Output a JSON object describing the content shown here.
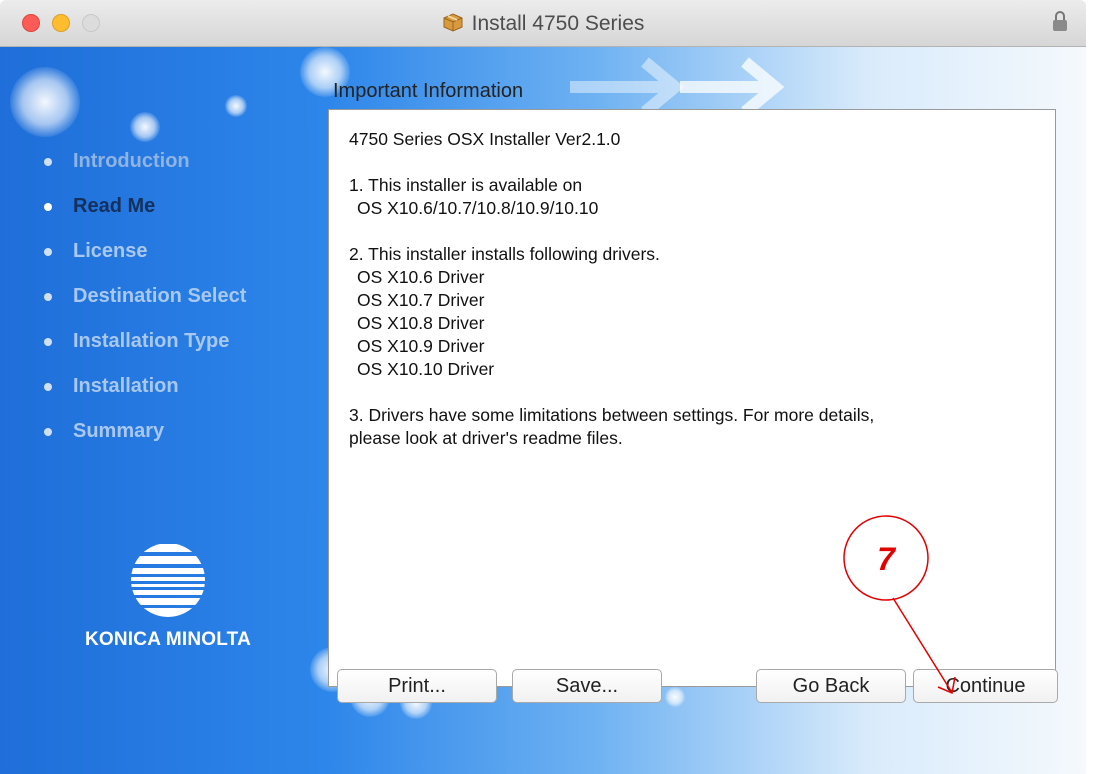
{
  "window": {
    "title": "Install 4750 Series"
  },
  "sidebar": {
    "steps": [
      {
        "label": "Introduction",
        "state": "done"
      },
      {
        "label": "Read Me",
        "state": "current"
      },
      {
        "label": "License",
        "state": "pending"
      },
      {
        "label": "Destination Select",
        "state": "pending"
      },
      {
        "label": "Installation Type",
        "state": "pending"
      },
      {
        "label": "Installation",
        "state": "pending"
      },
      {
        "label": "Summary",
        "state": "pending"
      }
    ],
    "logo_text": "KONICA MINOLTA"
  },
  "main": {
    "section_title": "Important Information",
    "content": {
      "line_version": "4750 Series OSX Installer Ver2.1.0",
      "item1_title": "1. This installer is available on",
      "item1_detail": "OS X10.6/10.7/10.8/10.9/10.10",
      "item2_title": "2. This installer installs following drivers.",
      "drivers": [
        "OS X10.6 Driver",
        "OS X10.7 Driver",
        "OS X10.8 Driver",
        "OS X10.9 Driver",
        "OS X10.10 Driver"
      ],
      "item3_line1": "3. Drivers have some limitations between settings. For more details,",
      "item3_line2": "please look at driver's readme files."
    }
  },
  "buttons": {
    "print": "Print...",
    "save": "Save...",
    "go_back": "Go Back",
    "continue": "Continue"
  },
  "annotation": {
    "number": "7",
    "color": "#e30000"
  },
  "colors": {
    "sidebar_blue": "#1f6ed9",
    "current_step": "#14305c",
    "pending_step": "#a9c8ef"
  }
}
